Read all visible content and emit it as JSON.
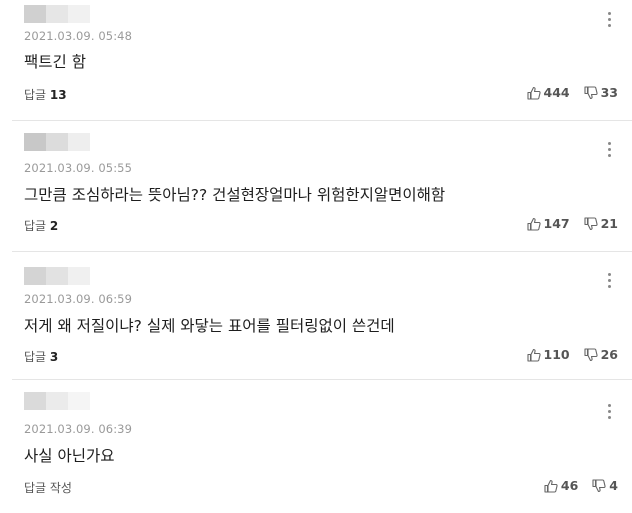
{
  "comments": [
    {
      "timestamp": "2021.03.09. 05:48",
      "text": "팩트긴 함",
      "reply_label": "답글",
      "reply_count": "13",
      "likes": "444",
      "dislikes": "33"
    },
    {
      "timestamp": "2021.03.09. 05:55",
      "text": "그만큼 조심하라는 뜻아님?? 건설현장얼마나 위험한지알면이해함",
      "reply_label": "답글",
      "reply_count": "2",
      "likes": "147",
      "dislikes": "21"
    },
    {
      "timestamp": "2021.03.09. 06:59",
      "text": "저게 왜 저질이냐? 실제 와닿는 표어를 필터링없이 쓴건데",
      "reply_label": "답글",
      "reply_count": "3",
      "likes": "110",
      "dislikes": "26"
    },
    {
      "timestamp": "2021.03.09. 06:39",
      "text": "사실 아닌가요",
      "reply_label": "답글 작성",
      "reply_count": "",
      "likes": "46",
      "dislikes": "4"
    }
  ],
  "icons": {
    "more": "more-vertical-icon",
    "like": "thumbs-up-icon",
    "dislike": "thumbs-down-icon"
  }
}
